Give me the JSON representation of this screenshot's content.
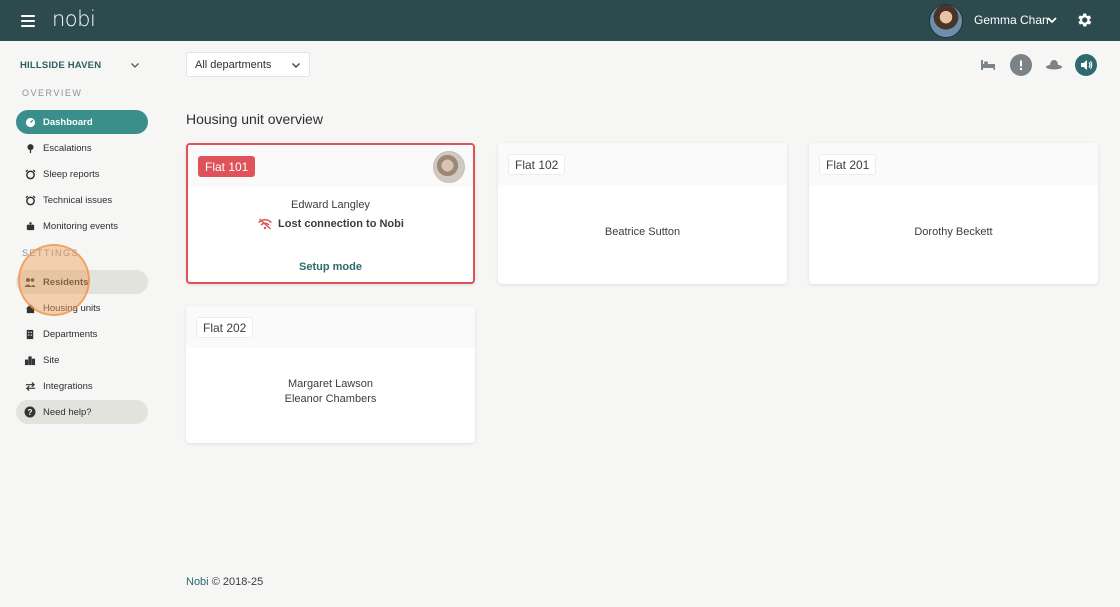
{
  "topbar": {
    "logo": "nobi",
    "user_name": "Gemma Chan"
  },
  "sidebar": {
    "site_name": "HILLSIDE HAVEN",
    "overview_label": "OVERVIEW",
    "settings_label": "SETTINGS",
    "overview_items": [
      {
        "label": "Dashboard",
        "icon": "dashboard-icon"
      },
      {
        "label": "Escalations",
        "icon": "escalations-icon"
      },
      {
        "label": "Sleep reports",
        "icon": "alarm-icon"
      },
      {
        "label": "Technical issues",
        "icon": "alarm-icon"
      },
      {
        "label": "Monitoring events",
        "icon": "monitoring-icon"
      }
    ],
    "settings_items": [
      {
        "label": "Residents",
        "icon": "people-icon"
      },
      {
        "label": "Housing units",
        "icon": "home-icon"
      },
      {
        "label": "Departments",
        "icon": "building-icon"
      },
      {
        "label": "Site",
        "icon": "city-icon"
      },
      {
        "label": "Integrations",
        "icon": "swap-icon"
      }
    ],
    "help_label": "Need help?"
  },
  "filter": {
    "department": "All departments"
  },
  "main": {
    "title": "Housing unit overview",
    "units": [
      {
        "name": "Flat 101",
        "residents": [
          "Edward Langley"
        ],
        "status": "Lost connection to Nobi",
        "action": "Setup mode",
        "alert": true
      },
      {
        "name": "Flat 102",
        "residents": [
          "Beatrice Sutton"
        ]
      },
      {
        "name": "Flat 201",
        "residents": [
          "Dorothy Beckett"
        ]
      },
      {
        "name": "Flat 202",
        "residents": [
          "Margaret Lawson",
          "Eleanor Chambers"
        ]
      }
    ]
  },
  "footer": {
    "brand": "Nobi",
    "copyright": "© 2018-25"
  },
  "colors": {
    "topbar": "#2d4a4f",
    "accent": "#3a8f8c",
    "alert": "#e0525a",
    "background": "#f6f6f4"
  }
}
